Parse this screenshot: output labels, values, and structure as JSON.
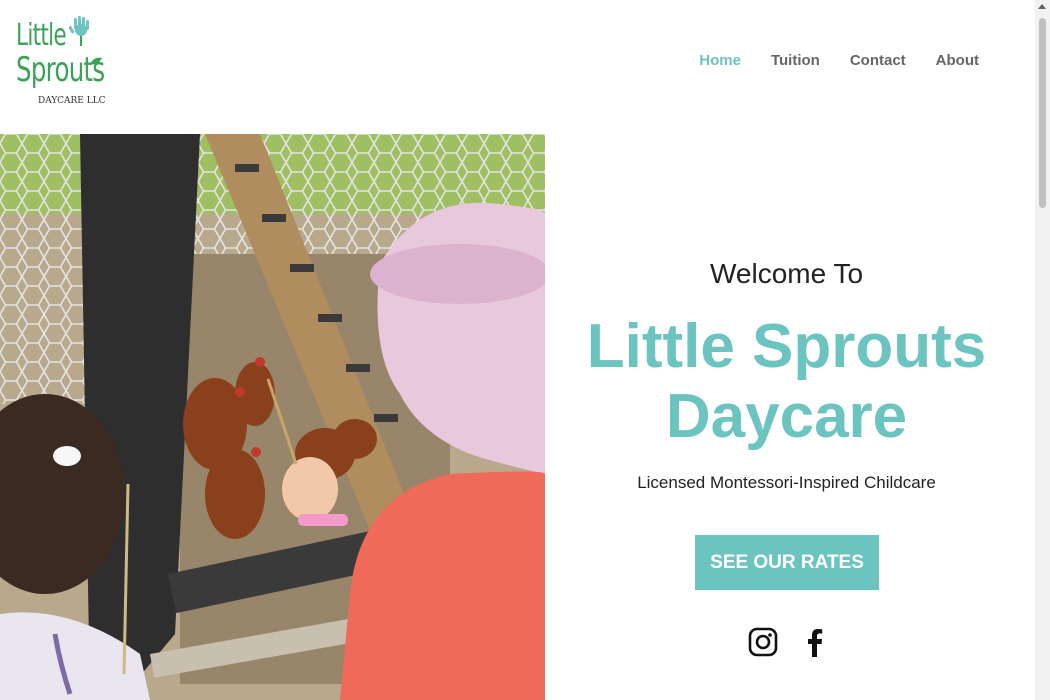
{
  "logo": {
    "line1": "Little",
    "line2": "Sprouts",
    "line3": "DAYCARE LLC"
  },
  "nav": {
    "items": [
      {
        "label": "Home",
        "active": true
      },
      {
        "label": "Tuition",
        "active": false
      },
      {
        "label": "Contact",
        "active": false
      },
      {
        "label": "About",
        "active": false
      }
    ]
  },
  "hero": {
    "welcome": "Welcome To",
    "title_line1": "Little Sprouts",
    "title_line2": "Daycare",
    "subtitle": "Licensed Montessori-Inspired Childcare",
    "cta_label": "SEE OUR RATES"
  },
  "social": [
    "instagram-icon",
    "facebook-icon"
  ],
  "colors": {
    "accent": "#6cc4c1",
    "logo_green": "#3aa357",
    "text": "#222222",
    "nav_text": "#666666"
  }
}
